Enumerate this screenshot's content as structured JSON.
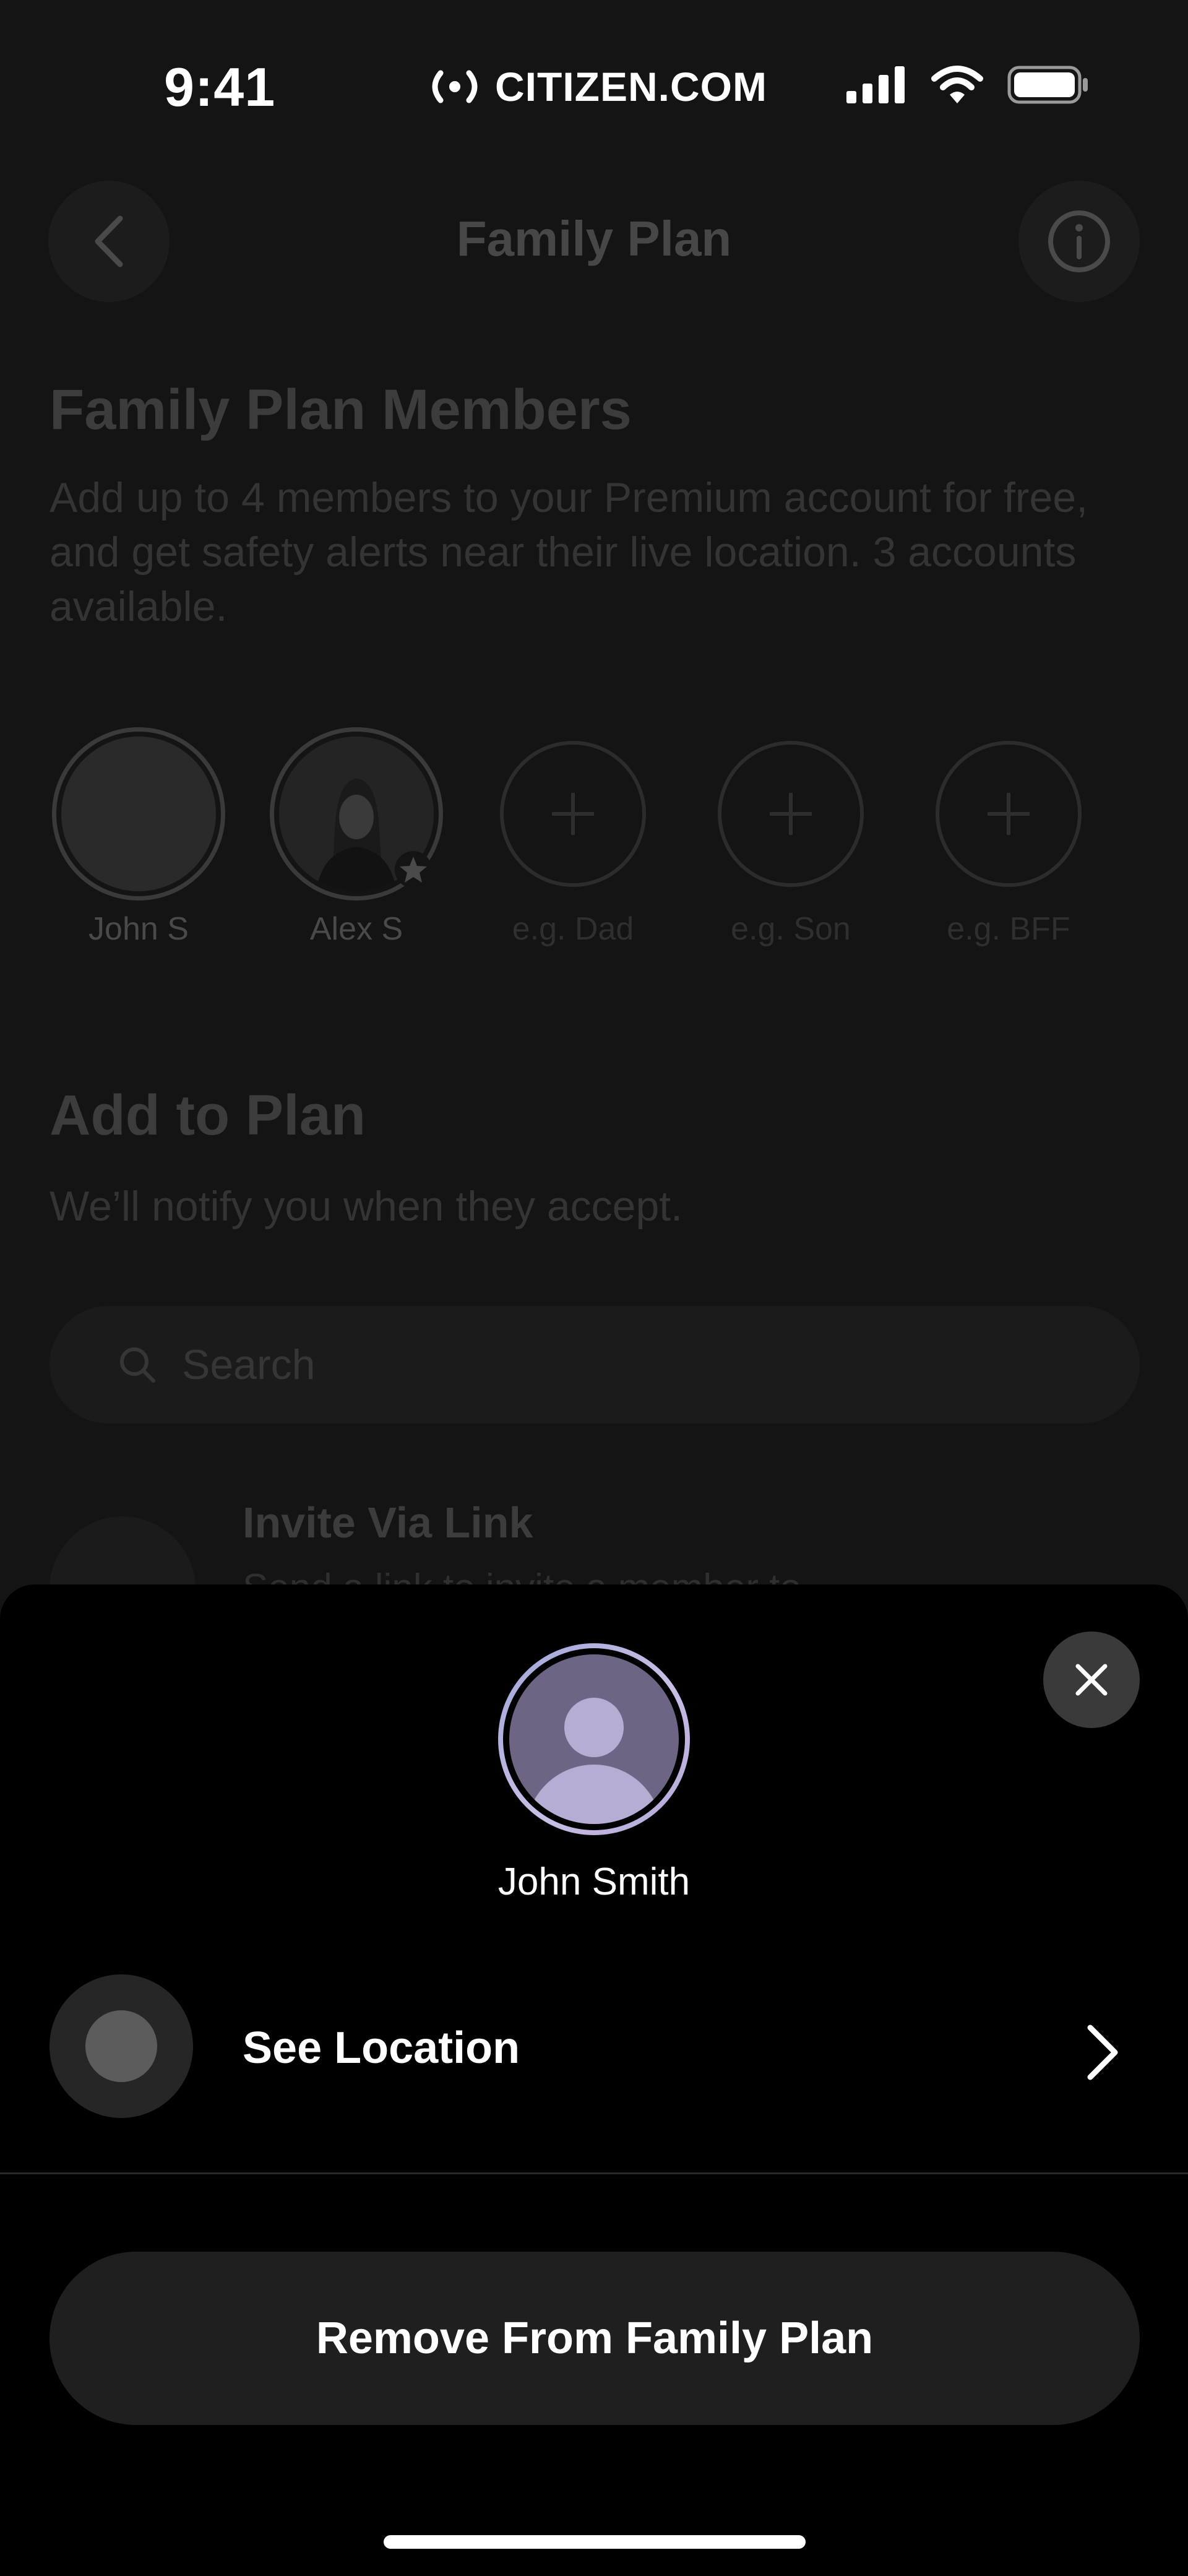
{
  "status_bar": {
    "time": "9:41",
    "brand": "CITIZEN.COM",
    "icons": [
      "signal-icon",
      "wifi-icon",
      "battery-icon"
    ]
  },
  "nav": {
    "title": "Family Plan",
    "back_icon": "chevron-left-icon",
    "info_icon": "info-icon"
  },
  "members_section": {
    "title": "Family Plan Members",
    "description": "Add up to 4 members to your Premium account for free, and get safety alerts near their live location. 3 accounts available.",
    "members": [
      {
        "name": "John S",
        "type": "member"
      },
      {
        "name": "Alex S",
        "type": "owner",
        "badge_icon": "star-icon"
      },
      {
        "name": "e.g. Dad",
        "type": "empty"
      },
      {
        "name": "e.g. Son",
        "type": "empty"
      },
      {
        "name": "e.g. BFF",
        "type": "empty"
      }
    ]
  },
  "add_section": {
    "title": "Add to Plan",
    "subtitle": "We’ll notify you when they accept.",
    "search_placeholder": "Search",
    "invite_title": "Invite Via Link",
    "invite_subtitle": "Send a link to invite a member to"
  },
  "sheet": {
    "member_name": "John Smith",
    "see_location_label": "See Location",
    "remove_label": "Remove From Family Plan",
    "close_icon": "close-icon"
  },
  "colors": {
    "background": "#000000",
    "dim_background": "#141414",
    "button_bg": "#1f1f1f",
    "avatar_ring": "#c9bfe6"
  }
}
